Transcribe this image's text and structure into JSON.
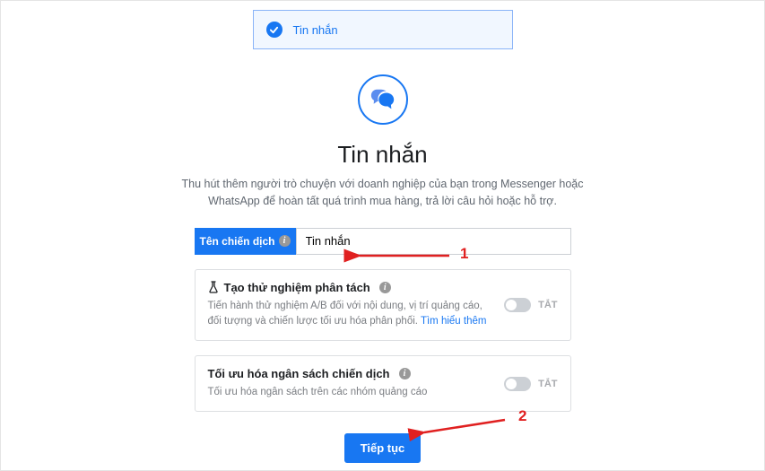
{
  "banner": {
    "label": "Tin nhắn"
  },
  "hero": {
    "title": "Tin nhắn",
    "description": "Thu hút thêm người trò chuyện với doanh nghiệp của bạn trong Messenger hoặc WhatsApp để hoàn tất quá trình mua hàng, trả lời câu hỏi hoặc hỗ trợ."
  },
  "campaign_name": {
    "label": "Tên chiến dịch",
    "value": "Tin nhắn"
  },
  "split_test": {
    "title": "Tạo thử nghiệm phân tách",
    "desc_prefix": "Tiến hành thử nghiệm A/B đối với nội dung, vị trí quảng cáo, đối tượng và chiến lược tối ưu hóa phân phối. ",
    "learn_more": "Tìm hiểu thêm",
    "toggle_label": "TẮT"
  },
  "budget_opt": {
    "title": "Tối ưu hóa ngân sách chiến dịch",
    "desc": "Tối ưu hóa ngân sách trên các nhóm quảng cáo",
    "toggle_label": "TẮT"
  },
  "continue_label": "Tiếp tục",
  "annotations": {
    "one": "1",
    "two": "2"
  }
}
